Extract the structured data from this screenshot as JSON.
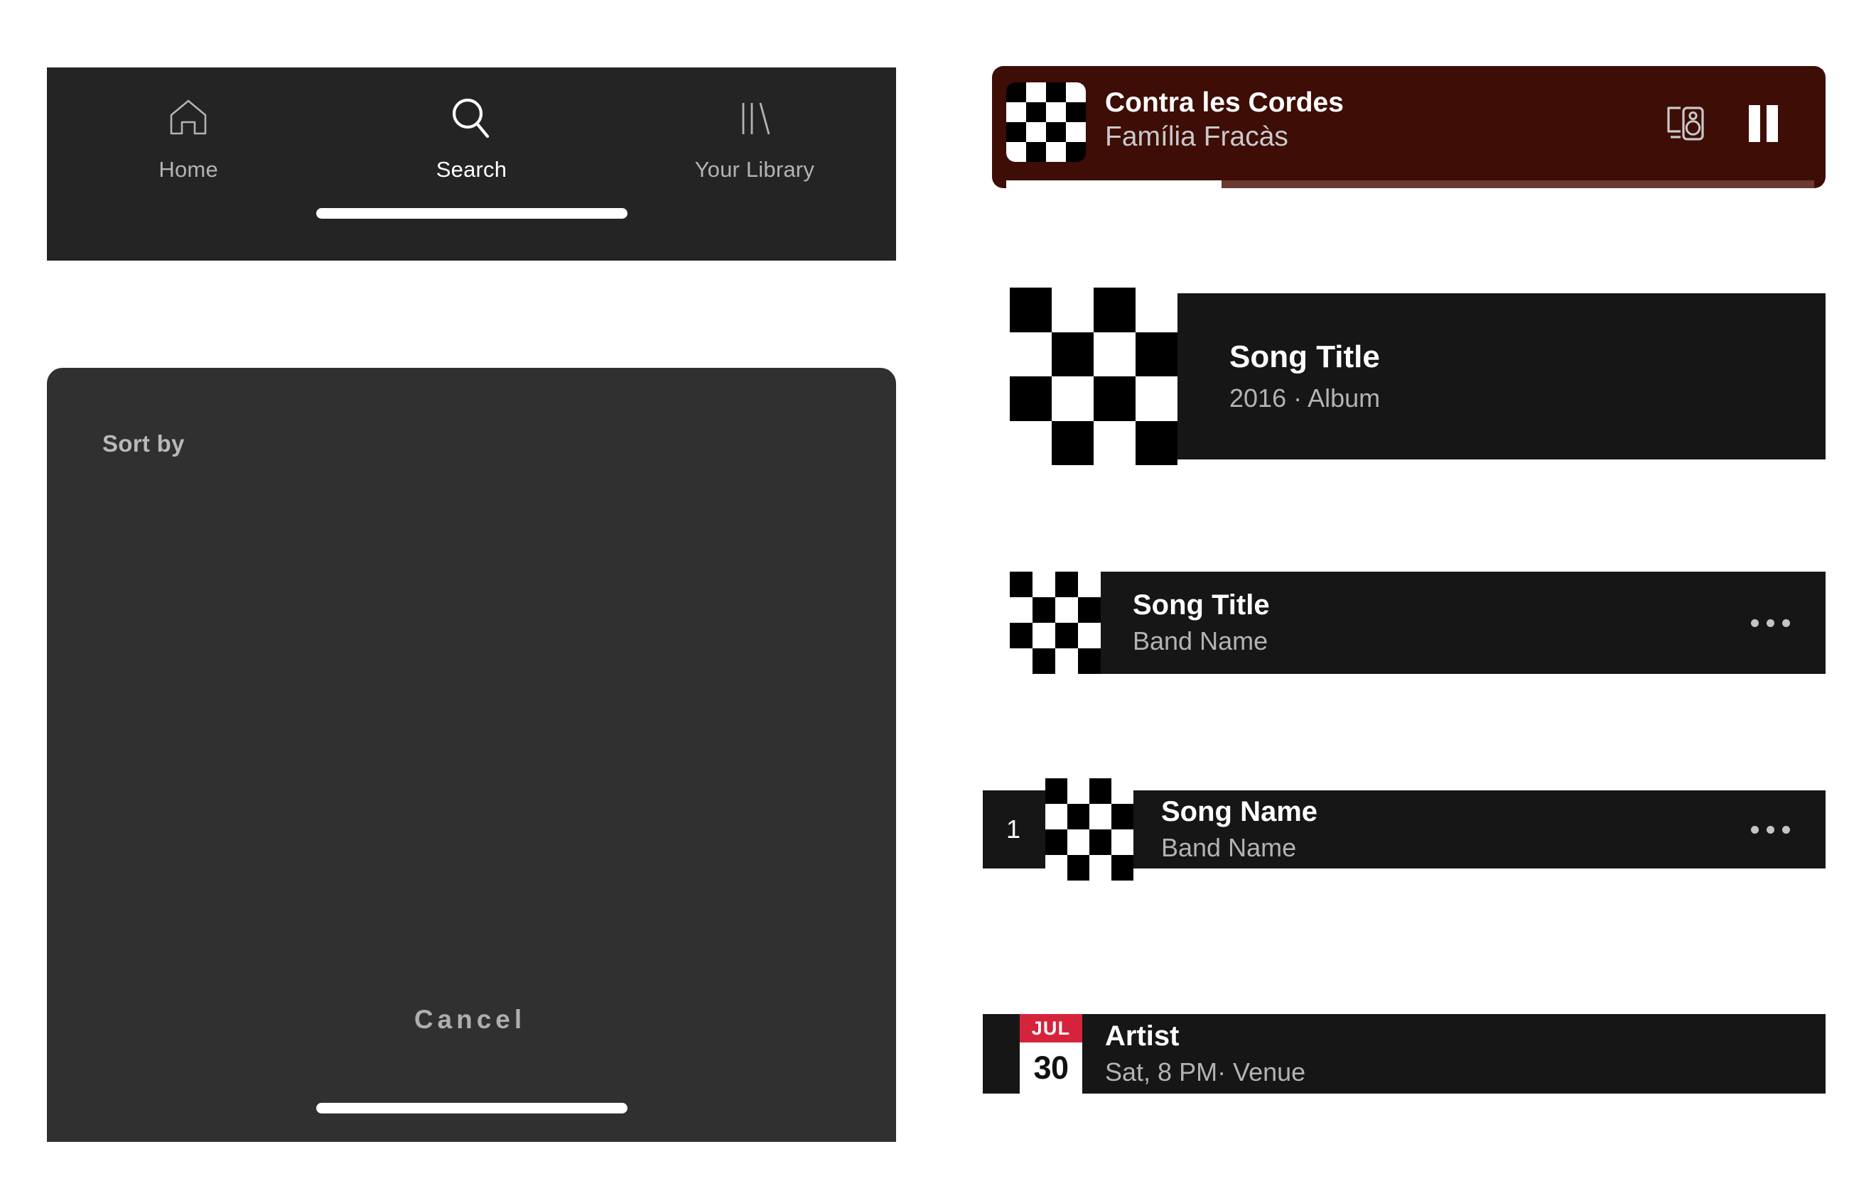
{
  "colors": {
    "page_background": "#ffffff",
    "navbar_background": "#242424",
    "sheet_background": "#303030",
    "card_background": "#161616",
    "nowplaying_background": "#3d0d06",
    "accent_red": "#d6233c",
    "text_primary": "#ffffff",
    "text_secondary": "#b3b3b3"
  },
  "navbar": {
    "items": [
      {
        "label": "Home",
        "icon": "home-icon",
        "active": false
      },
      {
        "label": "Search",
        "icon": "search-icon",
        "active": true
      },
      {
        "label": "Your Library",
        "icon": "library-icon",
        "active": false
      }
    ],
    "home_indicator": "home-indicator"
  },
  "sort_sheet": {
    "title": "Sort by",
    "cancel_label": "Cancel",
    "home_indicator": "home-indicator"
  },
  "now_playing": {
    "album_art": "checkerboard-album-art",
    "title": "Contra les Cordes",
    "artist": "Família Fracàs",
    "devices_icon": "connect-to-device-icon",
    "pause_icon": "pause-icon",
    "progress_percent": 26
  },
  "cards": {
    "album_result": {
      "album_art": "checkerboard-album-art",
      "title": "Song Title",
      "subtitle": "2016 · Album"
    },
    "song_row": {
      "album_art": "checkerboard-album-art",
      "title": "Song Title",
      "subtitle": "Band Name",
      "more_icon": "more-options-icon"
    },
    "track_row": {
      "number": "1",
      "album_art": "checkerboard-album-art",
      "title": "Song Name",
      "subtitle": "Band Name",
      "more_icon": "more-options-icon"
    },
    "event_row": {
      "month": "JUL",
      "day": "30",
      "title": "Artist",
      "subtitle": "Sat, 8 PM· Venue"
    }
  }
}
